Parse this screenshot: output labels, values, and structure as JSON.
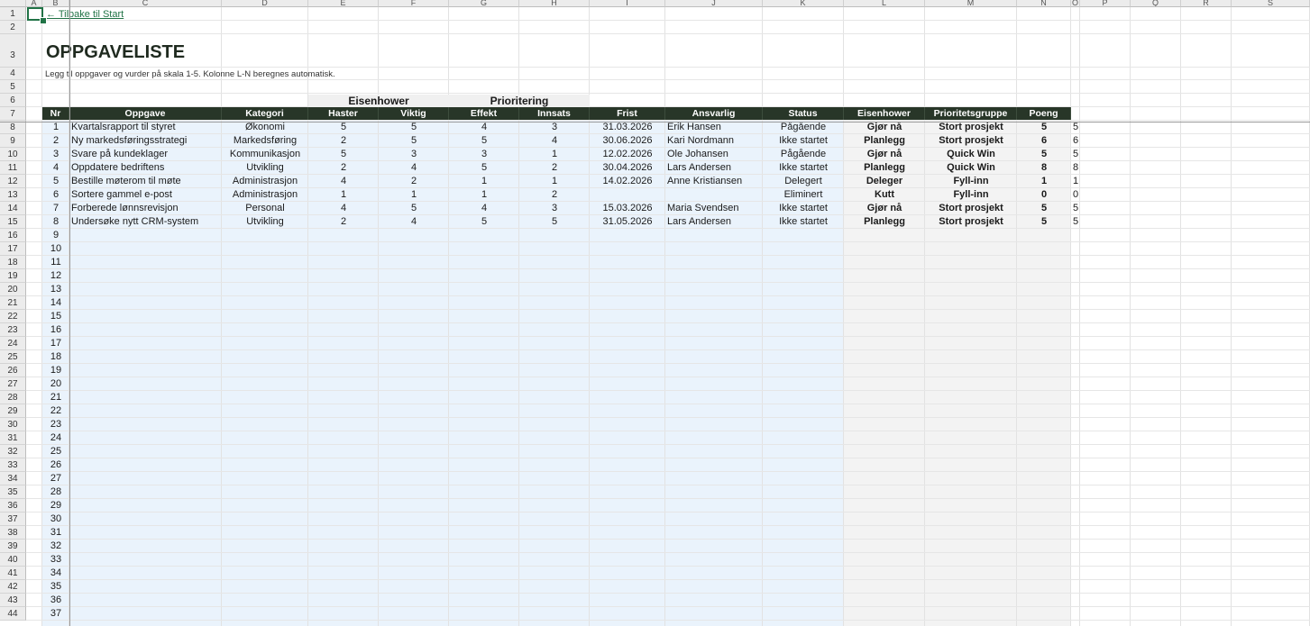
{
  "columns": [
    "A",
    "B",
    "C",
    "D",
    "E",
    "F",
    "G",
    "H",
    "I",
    "J",
    "K",
    "L",
    "M",
    "N",
    "O",
    "P",
    "Q",
    "R",
    "S"
  ],
  "header": {
    "back_link": "← Tilbake til Start",
    "title": "OPPGAVELISTE",
    "subtitle": "Legg til oppgaver og vurder på skala 1-5. Kolonne L-N beregnes automatisk.",
    "group_eisenhower": "Eisenhower",
    "group_prioritering": "Prioritering"
  },
  "table": {
    "headers": [
      "Nr",
      "Oppgave",
      "Kategori",
      "Haster",
      "Viktig",
      "Effekt",
      "Innsats",
      "Frist",
      "Ansvarlig",
      "Status",
      "Eisenhower",
      "Prioritetsgruppe",
      "Poeng"
    ],
    "rows": [
      {
        "nr": "1",
        "task": "Kvartalsrapport til styret",
        "category": "Økonomi",
        "haster": "5",
        "viktig": "5",
        "effekt": "4",
        "innsats": "3",
        "frist": "31.03.2026",
        "ansvarlig": "Erik Hansen",
        "status": "Pågående",
        "eisenhower": "Gjør nå",
        "group": "Stort prosjekt",
        "poeng": "5",
        "extra": "5"
      },
      {
        "nr": "2",
        "task": "Ny markedsføringsstrategi",
        "category": "Markedsføring",
        "haster": "2",
        "viktig": "5",
        "effekt": "5",
        "innsats": "4",
        "frist": "30.06.2026",
        "ansvarlig": "Kari Nordmann",
        "status": "Ikke startet",
        "eisenhower": "Planlegg",
        "group": "Stort prosjekt",
        "poeng": "6",
        "extra": "6"
      },
      {
        "nr": "3",
        "task": "Svare på kundeklager",
        "category": "Kommunikasjon",
        "haster": "5",
        "viktig": "3",
        "effekt": "3",
        "innsats": "1",
        "frist": "12.02.2026",
        "ansvarlig": "Ole Johansen",
        "status": "Pågående",
        "eisenhower": "Gjør nå",
        "group": "Quick Win",
        "poeng": "5",
        "extra": "5"
      },
      {
        "nr": "4",
        "task": "Oppdatere bedriftens",
        "category": "Utvikling",
        "haster": "2",
        "viktig": "4",
        "effekt": "5",
        "innsats": "2",
        "frist": "30.04.2026",
        "ansvarlig": "Lars Andersen",
        "status": "Ikke startet",
        "eisenhower": "Planlegg",
        "group": "Quick Win",
        "poeng": "8",
        "extra": "8"
      },
      {
        "nr": "5",
        "task": "Bestille møterom til møte",
        "category": "Administrasjon",
        "haster": "4",
        "viktig": "2",
        "effekt": "1",
        "innsats": "1",
        "frist": "14.02.2026",
        "ansvarlig": "Anne Kristiansen",
        "status": "Delegert",
        "eisenhower": "Deleger",
        "group": "Fyll-inn",
        "poeng": "1",
        "extra": "1"
      },
      {
        "nr": "6",
        "task": "Sortere gammel e-post",
        "category": "Administrasjon",
        "haster": "1",
        "viktig": "1",
        "effekt": "1",
        "innsats": "2",
        "frist": "",
        "ansvarlig": "",
        "status": "Eliminert",
        "eisenhower": "Kutt",
        "group": "Fyll-inn",
        "poeng": "0",
        "extra": "0"
      },
      {
        "nr": "7",
        "task": "Forberede lønnsrevisjon",
        "category": "Personal",
        "haster": "4",
        "viktig": "5",
        "effekt": "4",
        "innsats": "3",
        "frist": "15.03.2026",
        "ansvarlig": "Maria Svendsen",
        "status": "Ikke startet",
        "eisenhower": "Gjør nå",
        "group": "Stort prosjekt",
        "poeng": "5",
        "extra": "5"
      },
      {
        "nr": "8",
        "task": "Undersøke nytt CRM-system",
        "category": "Utvikling",
        "haster": "2",
        "viktig": "4",
        "effekt": "5",
        "innsats": "5",
        "frist": "31.05.2026",
        "ansvarlig": "Lars Andersen",
        "status": "Ikke startet",
        "eisenhower": "Planlegg",
        "group": "Stort prosjekt",
        "poeng": "5",
        "extra": "5"
      }
    ],
    "empty_nrs": [
      "9",
      "10",
      "11",
      "12",
      "13",
      "14",
      "15",
      "16",
      "17",
      "18",
      "19",
      "20",
      "21",
      "22",
      "23",
      "24",
      "25",
      "26",
      "27",
      "28",
      "29",
      "30",
      "31",
      "32",
      "33",
      "34",
      "35",
      "36",
      "37"
    ]
  },
  "row_numbers": [
    "1",
    "2",
    "3",
    "4",
    "5",
    "6",
    "7",
    "8",
    "9",
    "10",
    "11",
    "12",
    "13",
    "14",
    "15",
    "16",
    "17",
    "18",
    "19",
    "20",
    "21",
    "22",
    "23",
    "24",
    "25",
    "26",
    "27",
    "28",
    "29",
    "30",
    "31",
    "32",
    "33",
    "34",
    "35",
    "36",
    "37",
    "38",
    "39",
    "40",
    "41",
    "42",
    "43",
    "44"
  ],
  "colors": {
    "header_bg": "#283628",
    "band_blue": "#eaf3fc",
    "band_gray": "#f3f3f3",
    "accent": "#217346"
  }
}
